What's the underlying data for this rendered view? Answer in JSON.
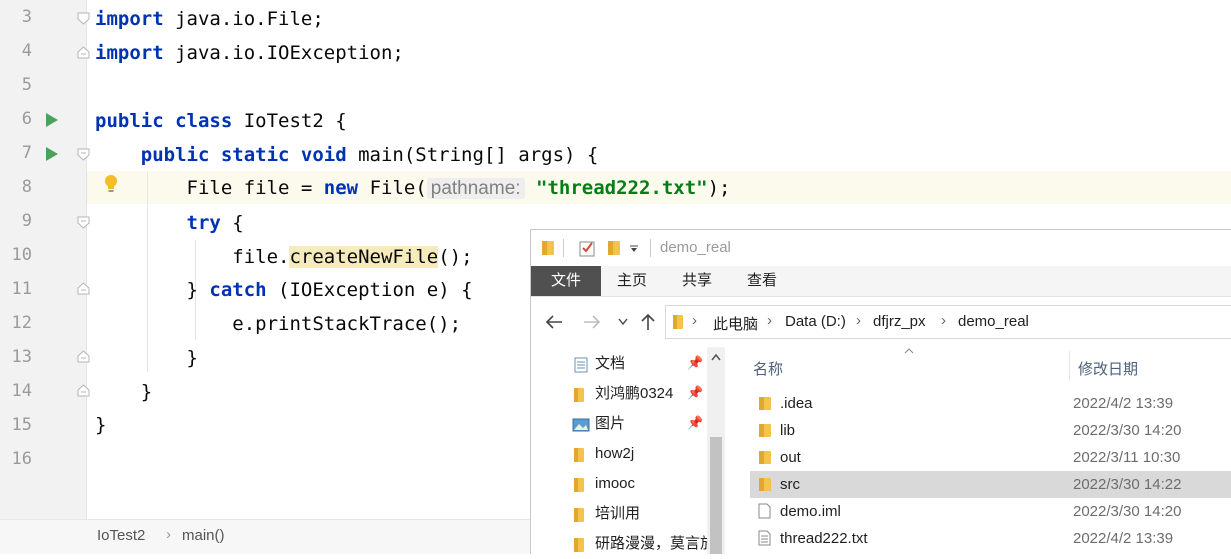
{
  "ide": {
    "line_numbers": [
      "3",
      "4",
      "5",
      "6",
      "7",
      "8",
      "9",
      "10",
      "11",
      "12",
      "13",
      "14",
      "15",
      "16"
    ],
    "lines": {
      "l3_kw": "import",
      "l3_rest": " java.io.File;",
      "l4_kw": "import",
      "l4_rest": " java.io.IOException;",
      "l6_kw": "public class",
      "l6_rest": " IoTest2 {",
      "l7_indent": "    ",
      "l7_kw": "public static void",
      "l7_rest": " main(String[] args) {",
      "l8_indent": "        ",
      "l8_a": "File file = ",
      "l8_kw": "new",
      "l8_b": " File(",
      "l8_hint": "pathname:",
      "l8_str": "\"thread222.txt\"",
      "l8_c": ");",
      "l9_indent": "        ",
      "l9_kw": "try",
      "l9_rest": " {",
      "l10_indent": "            ",
      "l10_a": "file.",
      "l10_method": "createNewFile",
      "l10_b": "();",
      "l11_indent": "        ",
      "l11_a": "} ",
      "l11_kw": "catch",
      "l11_rest": " (IOException e) {",
      "l12_indent": "            ",
      "l12_text": "e.printStackTrace();",
      "l13_indent": "        ",
      "l13_text": "}",
      "l14_indent": "    ",
      "l14_text": "}",
      "l15_text": "}"
    },
    "breadcrumb": {
      "class": "IoTest2",
      "sep": "›",
      "method": "main()"
    },
    "colors": {
      "keyword": "#0033b3",
      "string": "#067d17",
      "run": "#4aa35a",
      "current_line": "#fcfaed"
    }
  },
  "explorer": {
    "title": "demo_real",
    "ribbon_tabs": {
      "file": "文件",
      "home": "主页",
      "share": "共享",
      "view": "查看"
    },
    "address": {
      "pc": "此电脑",
      "drive": "Data (D:)",
      "folder1": "dfjrz_px",
      "folder2": "demo_real",
      "sep": "›"
    },
    "nav_items": [
      "文档",
      "刘鸿鹏0324",
      "图片",
      "how2j",
      "imooc",
      "培训用",
      "研路漫漫，莫言放"
    ],
    "columns": {
      "name": "名称",
      "date": "修改日期"
    },
    "files": [
      {
        "name": ".idea",
        "date": "2022/4/2 13:39",
        "type": "folder"
      },
      {
        "name": "lib",
        "date": "2022/3/30 14:20",
        "type": "folder"
      },
      {
        "name": "out",
        "date": "2022/3/11 10:30",
        "type": "folder"
      },
      {
        "name": "src",
        "date": "2022/3/30 14:22",
        "type": "folder"
      },
      {
        "name": "demo.iml",
        "date": "2022/3/30 14:20",
        "type": "file"
      },
      {
        "name": "thread222.txt",
        "date": "2022/4/2 13:39",
        "type": "text"
      }
    ],
    "selected_file": "src"
  }
}
